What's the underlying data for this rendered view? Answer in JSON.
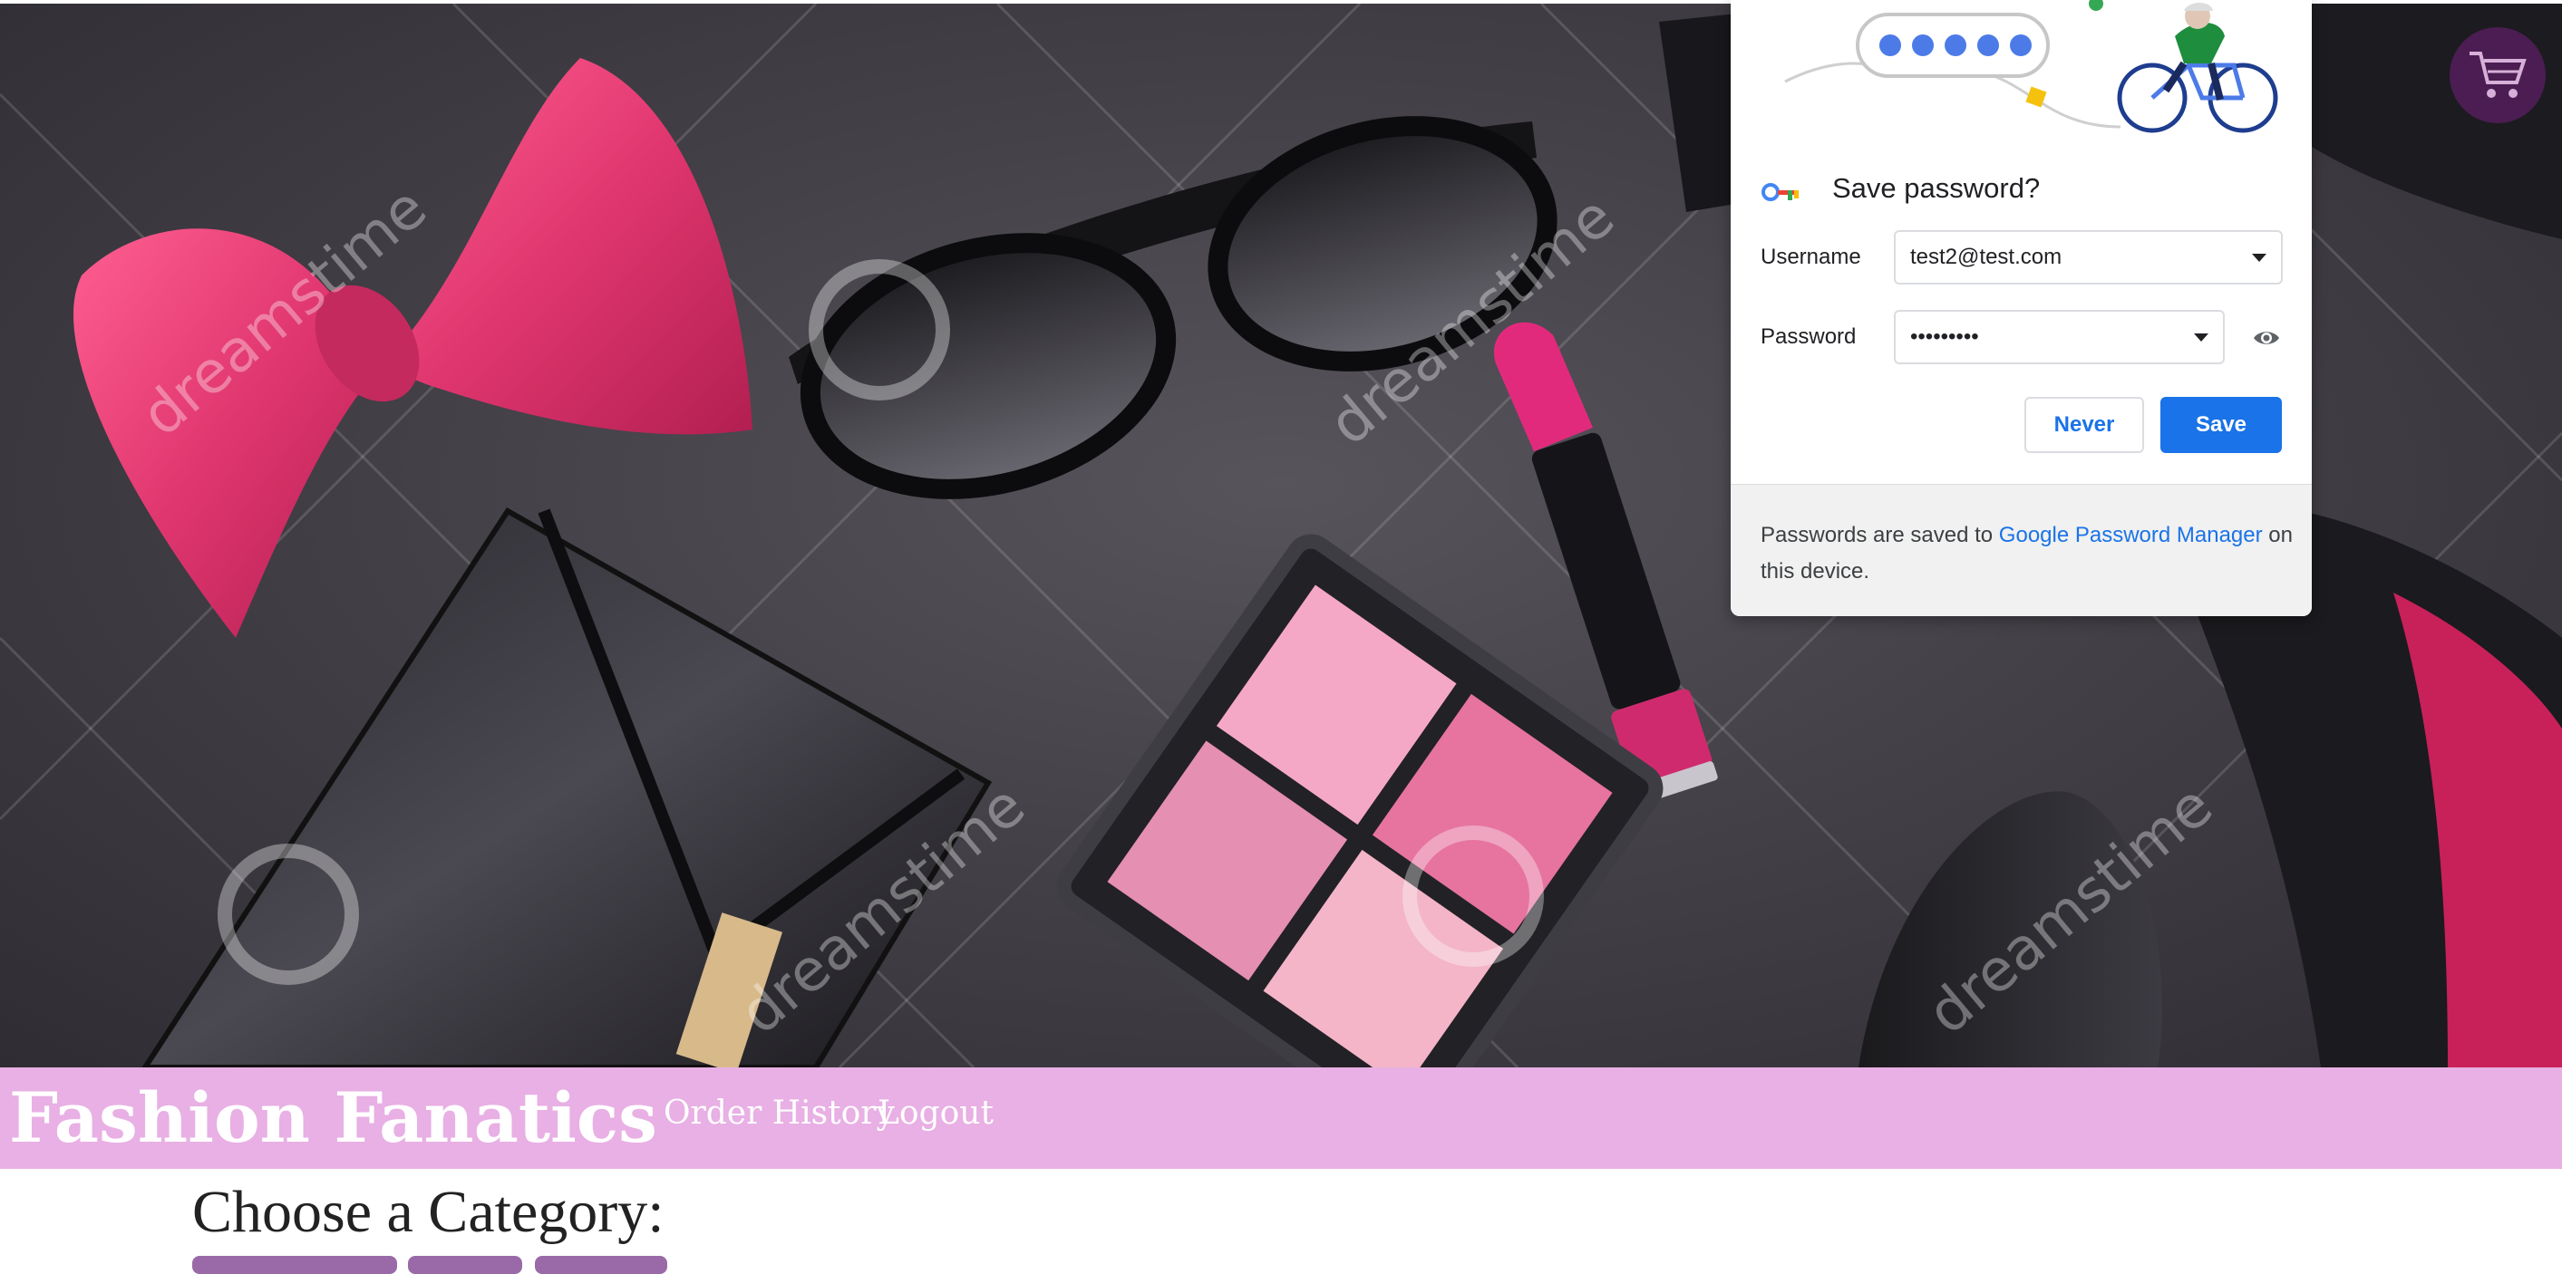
{
  "hero": {
    "watermark_text": "dreamstime",
    "description_icons": [
      "bow-tie",
      "sunglasses",
      "lipstick",
      "handbag",
      "eyeshadow-palette",
      "high-heel"
    ]
  },
  "cart": {
    "icon": "shopping-cart-icon"
  },
  "navbar": {
    "brand": "Fashion Fanatics",
    "links": [
      "Order History",
      "Logout"
    ]
  },
  "main": {
    "category_heading": "Choose a Category:"
  },
  "password_dialog": {
    "title": "Save password?",
    "username_label": "Username",
    "username_value": "test2@test.com",
    "password_label": "Password",
    "password_value": "•••••••••",
    "never_label": "Never",
    "save_label": "Save",
    "footer_prefix": "Passwords are saved to ",
    "footer_link": "Google Password Manager",
    "footer_suffix": " on this device."
  },
  "colors": {
    "navbar": "#e8b0e4",
    "accent_blue": "#1a73e8",
    "cart_bg": "#4b1d52"
  }
}
